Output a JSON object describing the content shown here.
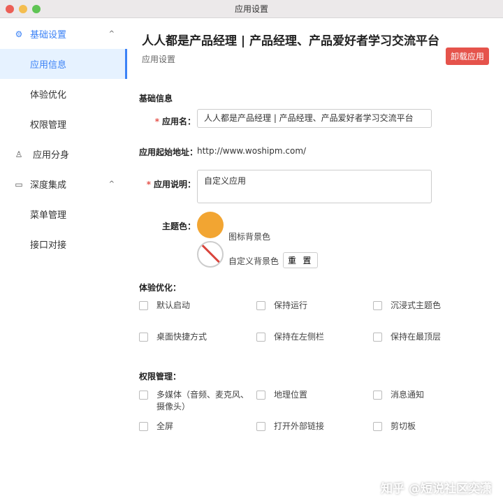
{
  "window": {
    "title": "应用设置"
  },
  "sidebar": {
    "group1": {
      "label": "基础设置",
      "items": [
        "应用信息",
        "体验优化",
        "权限管理"
      ]
    },
    "item_split": "应用分身",
    "group2": {
      "label": "深度集成",
      "items": [
        "菜单管理",
        "接口对接"
      ]
    }
  },
  "header": {
    "title": "人人都是产品经理 | 产品经理、产品爱好者学习交流平台",
    "subtitle": "应用设置",
    "uninstall_label": "卸载应用"
  },
  "basic": {
    "section": "基础信息",
    "name_label": "应用名：",
    "name_value": "人人都是产品经理 | 产品经理、产品爱好者学习交流平台",
    "url_label": "应用起始地址：",
    "url_value": "http://www.woshipm.com/",
    "desc_label": "应用说明：",
    "desc_value": "自定义应用",
    "theme_label": "主题色：",
    "theme_color": "#f2a532",
    "icon_bg_label": "图标背景色",
    "custom_bg_label": "自定义背景色",
    "reset_label": "重 置"
  },
  "experience": {
    "section": "体验优化：",
    "options": [
      "默认启动",
      "保持运行",
      "沉浸式主题色",
      "桌面快捷方式",
      "保持在左侧栏",
      "保持在最顶层"
    ]
  },
  "permissions": {
    "section": "权限管理：",
    "options": [
      "多媒体（音频、麦克风、摄像头）",
      "地理位置",
      "消息通知",
      "全屏",
      "打开外部链接",
      "剪切板"
    ]
  },
  "watermark": "知乎 @短说社区奕潇"
}
